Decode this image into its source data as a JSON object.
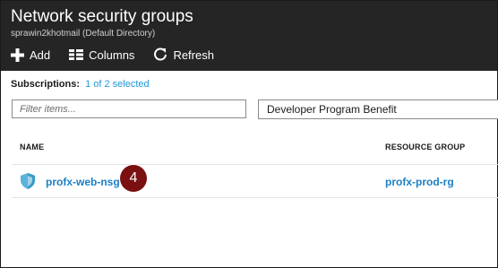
{
  "blade": {
    "title": "Network security groups",
    "subtitle": "sprawin2khotmail (Default Directory)"
  },
  "toolbar": {
    "add_label": "Add",
    "columns_label": "Columns",
    "refresh_label": "Refresh"
  },
  "subscriptions": {
    "label": "Subscriptions:",
    "selected_text": "1 of 2 selected"
  },
  "filter": {
    "placeholder": "Filter items...",
    "value": ""
  },
  "subscription_dropdown": {
    "selected": "Developer Program Benefit"
  },
  "table": {
    "columns": [
      "NAME",
      "RESOURCE GROUP"
    ],
    "rows": [
      {
        "name": "profx-web-nsg",
        "resource_group": "profx-prod-rg",
        "icon": "shield-icon"
      }
    ]
  },
  "annotation": {
    "step": "4",
    "color": "#7a1010"
  },
  "colors": {
    "header_bg": "#252526",
    "link": "#1b9ad6",
    "row_link": "#1b7fc4"
  }
}
